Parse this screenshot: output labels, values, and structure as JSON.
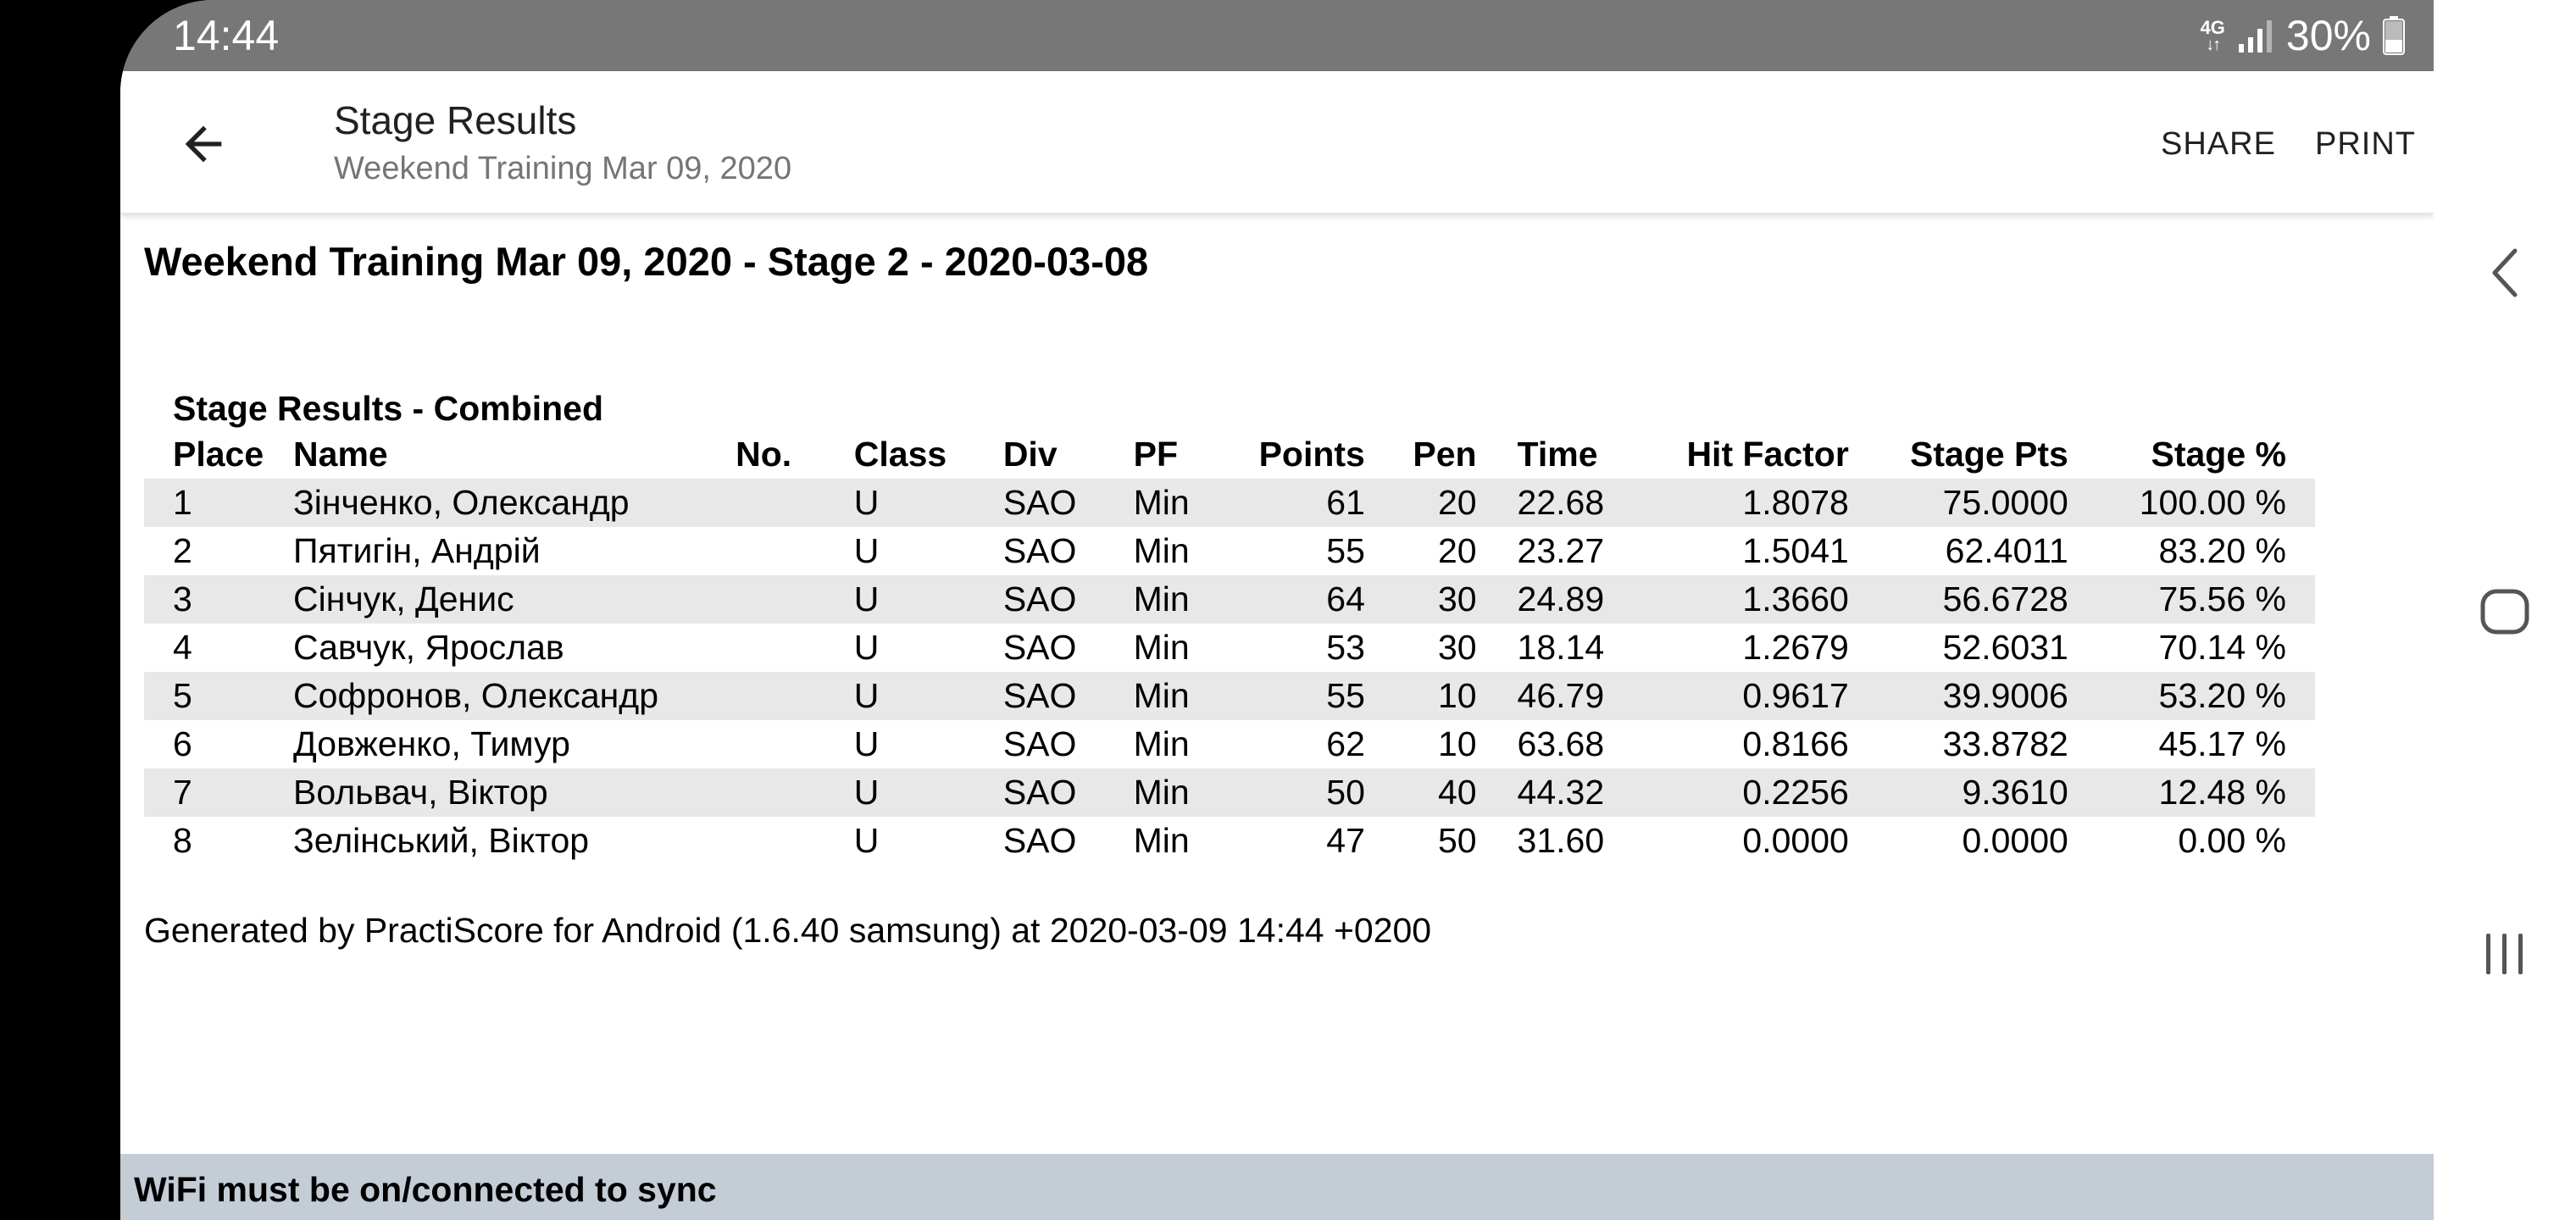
{
  "status_bar": {
    "time": "14:44",
    "network_type": "4G",
    "battery_percent": "30%",
    "icon_color": "#ffffff"
  },
  "app_bar": {
    "title": "Stage Results",
    "subtitle": "Weekend Training Mar 09, 2020",
    "back_icon": "arrow-back-icon",
    "actions": {
      "share": "SHARE",
      "print": "PRINT"
    }
  },
  "report": {
    "heading": "Weekend Training Mar 09, 2020 - Stage 2 - 2020-03-08",
    "table_caption": "Stage Results - Combined",
    "columns": {
      "place": "Place",
      "name": "Name",
      "no": "No.",
      "class": "Class",
      "div": "Div",
      "pf": "PF",
      "points": "Points",
      "pen": "Pen",
      "time": "Time",
      "hit_factor": "Hit Factor",
      "stage_pts": "Stage Pts",
      "stage_pct": "Stage %"
    },
    "rows": [
      {
        "place": "1",
        "name": "Зінченко, Олександр",
        "no": "",
        "class": "U",
        "div": "SAO",
        "pf": "Min",
        "points": "61",
        "pen": "20",
        "time": "22.68",
        "hit_factor": "1.8078",
        "stage_pts": "75.0000",
        "stage_pct": "100.00 %"
      },
      {
        "place": "2",
        "name": "Пятигін, Андрій",
        "no": "",
        "class": "U",
        "div": "SAO",
        "pf": "Min",
        "points": "55",
        "pen": "20",
        "time": "23.27",
        "hit_factor": "1.5041",
        "stage_pts": "62.4011",
        "stage_pct": "83.20 %"
      },
      {
        "place": "3",
        "name": "Сінчук, Денис",
        "no": "",
        "class": "U",
        "div": "SAO",
        "pf": "Min",
        "points": "64",
        "pen": "30",
        "time": "24.89",
        "hit_factor": "1.3660",
        "stage_pts": "56.6728",
        "stage_pct": "75.56 %"
      },
      {
        "place": "4",
        "name": "Савчук, Ярослав",
        "no": "",
        "class": "U",
        "div": "SAO",
        "pf": "Min",
        "points": "53",
        "pen": "30",
        "time": "18.14",
        "hit_factor": "1.2679",
        "stage_pts": "52.6031",
        "stage_pct": "70.14 %"
      },
      {
        "place": "5",
        "name": "Софронов, Олександр",
        "no": "",
        "class": "U",
        "div": "SAO",
        "pf": "Min",
        "points": "55",
        "pen": "10",
        "time": "46.79",
        "hit_factor": "0.9617",
        "stage_pts": "39.9006",
        "stage_pct": "53.20 %"
      },
      {
        "place": "6",
        "name": "Довженко, Тимур",
        "no": "",
        "class": "U",
        "div": "SAO",
        "pf": "Min",
        "points": "62",
        "pen": "10",
        "time": "63.68",
        "hit_factor": "0.8166",
        "stage_pts": "33.8782",
        "stage_pct": "45.17 %"
      },
      {
        "place": "7",
        "name": "Вольвач, Віктор",
        "no": "",
        "class": "U",
        "div": "SAO",
        "pf": "Min",
        "points": "50",
        "pen": "40",
        "time": "44.32",
        "hit_factor": "0.2256",
        "stage_pts": "9.3610",
        "stage_pct": "12.48 %"
      },
      {
        "place": "8",
        "name": "Зелінський, Віктор",
        "no": "",
        "class": "U",
        "div": "SAO",
        "pf": "Min",
        "points": "47",
        "pen": "50",
        "time": "31.60",
        "hit_factor": "0.0000",
        "stage_pts": "0.0000",
        "stage_pct": "0.00 %"
      }
    ],
    "footer": "Generated by PractiScore for Android (1.6.40 samsung) at 2020-03-09 14:44 +0200",
    "stripe_color": "#e8e8e8"
  },
  "sync_banner": {
    "text": "WiFi must be on/connected to sync",
    "background": "#c4ccd6"
  },
  "nav_bar": {
    "back_icon": "nav-back-icon",
    "home_icon": "nav-home-icon",
    "recents_icon": "nav-recents-icon"
  },
  "colors": {
    "status_bar": "#777777",
    "title_text": "#212121",
    "subtitle_text": "#757575"
  }
}
